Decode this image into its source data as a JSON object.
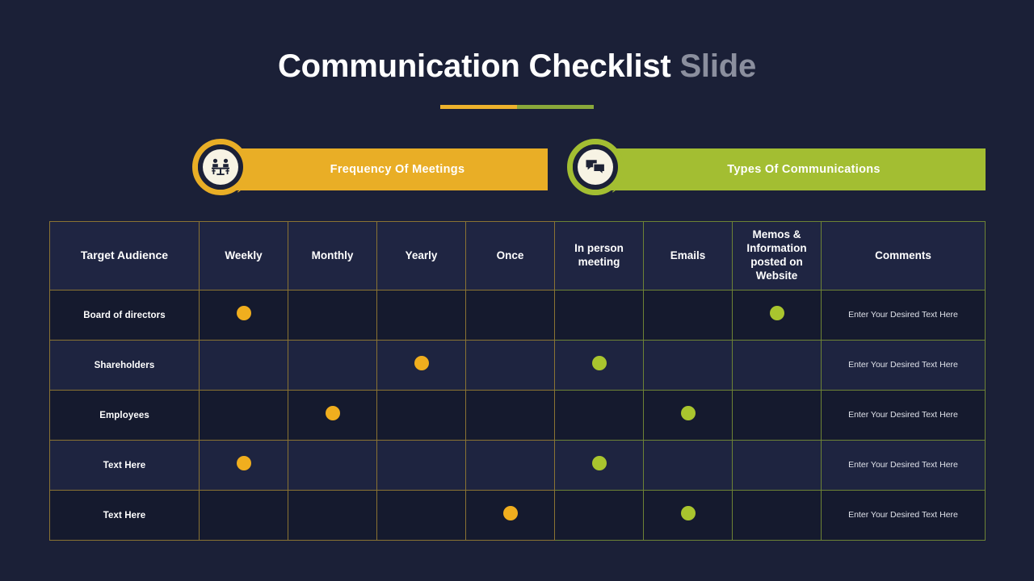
{
  "slide": {
    "title_main": "Communication Checklist",
    "title_accent": "Slide",
    "background_color": "#1b2037"
  },
  "banners": [
    {
      "id": "frequency",
      "label": "Frequency Of Meetings",
      "color": "#e9ae26",
      "icon": "meeting-table-icon"
    },
    {
      "id": "types",
      "label": "Types Of Communications",
      "color": "#a3be32",
      "icon": "chat-bubbles-icon"
    }
  ],
  "accent_colors": {
    "amber": "#e9ae26",
    "green": "#a3be32",
    "dot_amber": "#f0ae1e",
    "dot_green": "#a9c52e",
    "border_amber": "#8a7333",
    "border_green": "#6d8335"
  },
  "table": {
    "headers": [
      "Target Audience",
      "Weekly",
      "Monthly",
      "Yearly",
      "Once",
      "In person meeting",
      "Emails",
      "Memos & Information posted on Website",
      "Comments"
    ],
    "rows": [
      {
        "label": "Board of directors",
        "weekly": "amber",
        "monthly": "",
        "yearly": "",
        "once": "",
        "in_person_meeting": "",
        "emails": "",
        "memos_website": "green",
        "comment": "Enter Your Desired Text Here"
      },
      {
        "label": "Shareholders",
        "weekly": "",
        "monthly": "",
        "yearly": "amber",
        "once": "",
        "in_person_meeting": "green",
        "emails": "",
        "memos_website": "",
        "comment": "Enter Your Desired Text Here"
      },
      {
        "label": "Employees",
        "weekly": "",
        "monthly": "amber",
        "yearly": "",
        "once": "",
        "in_person_meeting": "",
        "emails": "green",
        "memos_website": "",
        "comment": "Enter Your Desired Text Here"
      },
      {
        "label": "Text Here",
        "weekly": "amber",
        "monthly": "",
        "yearly": "",
        "once": "",
        "in_person_meeting": "green",
        "emails": "",
        "memos_website": "",
        "comment": "Enter Your Desired Text Here"
      },
      {
        "label": "Text Here",
        "weekly": "",
        "monthly": "",
        "yearly": "",
        "once": "amber",
        "in_person_meeting": "",
        "emails": "green",
        "memos_website": "",
        "comment": "Enter Your Desired Text Here"
      }
    ]
  }
}
